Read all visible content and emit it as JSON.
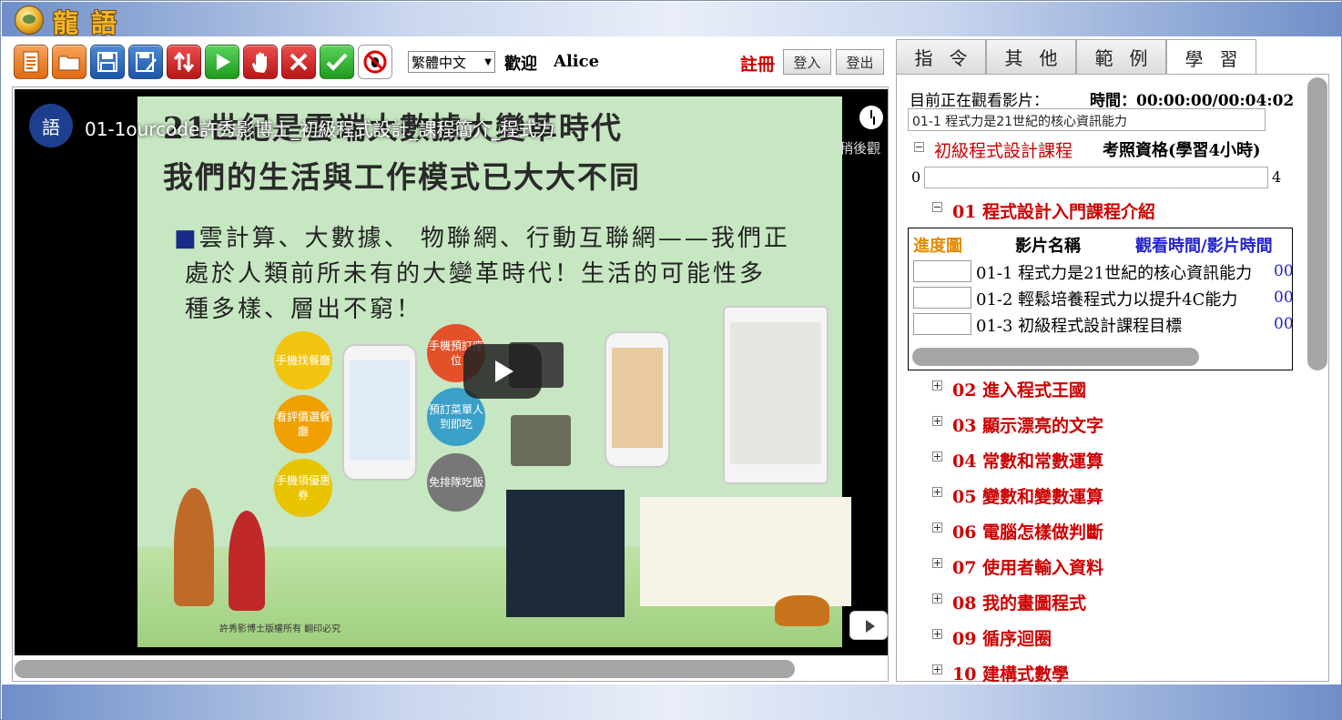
{
  "app": {
    "title_text": "龍語"
  },
  "toolbar": {
    "buttons": [
      {
        "name": "new-document-button",
        "color": "orange"
      },
      {
        "name": "open-folder-button",
        "color": "orange"
      },
      {
        "name": "save-button",
        "color": "blue"
      },
      {
        "name": "save-as-button",
        "color": "blue"
      },
      {
        "name": "sort-button",
        "color": "red"
      },
      {
        "name": "run-button",
        "color": "green"
      },
      {
        "name": "stop-button",
        "color": "red"
      },
      {
        "name": "close-button",
        "color": "red"
      },
      {
        "name": "check-button",
        "color": "green"
      },
      {
        "name": "no-debug-button",
        "color": "white"
      }
    ],
    "language": "繁體中文",
    "welcome": "歡迎",
    "username": "Alice",
    "register": "註冊",
    "login": "登入",
    "logout": "登出"
  },
  "video": {
    "channel_avatar": "語",
    "title": "01-1ourcode許秀影博士_初級程式設計_課程簡介_程式力",
    "watch_later": "稍後觀",
    "slide": {
      "heading1": "21世紀是雲端大數據大變革時代",
      "heading2": "我們的生活與工作模式已大大不同",
      "bullet_line1": "雲計算、大數據、 物聯網、行動互聯網——我們正",
      "bullet_line2": "處於人類前所未有的大變革時代！生活的可能性多",
      "bullet_line3": "種多樣、層出不窮！",
      "bubbles": [
        "手機找餐廳",
        "看評價選餐廳",
        "手機領優惠券",
        "手機預訂座位",
        "預訂菜單人到即吃",
        "免排隊吃飯"
      ],
      "copyright": "許秀影博士版權所有 翻印必究"
    }
  },
  "tabs": [
    {
      "label": "指令",
      "active": false
    },
    {
      "label": "其他",
      "active": false
    },
    {
      "label": "範例",
      "active": false
    },
    {
      "label": "學習",
      "active": true
    }
  ],
  "learning": {
    "now_watching_label": "目前正在觀看影片：",
    "time_label": "時間：00:00:00/00:04:02",
    "now_watching_value": "01-1 程式力是21世紀的核心資訊能力",
    "course_title": "初級程式設計課程",
    "course_sub": "考照資格(學習4小時)",
    "progress_min": "0",
    "progress_max": "4",
    "progress_value": 0,
    "open_chapter": "01 程式設計入門課程介紹",
    "table": {
      "col_progress": "進度圖",
      "col_name": "影片名稱",
      "col_time": "觀看時間/影片時間",
      "rows": [
        {
          "name": "01-1 程式力是21世紀的核心資訊能力",
          "time": "00"
        },
        {
          "name": "01-2 輕鬆培養程式力以提升4C能力",
          "time": "00"
        },
        {
          "name": "01-3 初級程式設計課程目標",
          "time": "00"
        }
      ]
    },
    "chapters": [
      "02 進入程式王國",
      "03 顯示漂亮的文字",
      "04 常數和常數運算",
      "05 變數和變數運算",
      "06 電腦怎樣做判斷",
      "07 使用者輸入資料",
      "08 我的畫圖程式",
      "09 循序迴圈",
      "10 建構式數學"
    ]
  },
  "colors": {
    "accent_red": "#cc0000",
    "link_blue": "#2222cc",
    "orange": "#e58a00"
  }
}
